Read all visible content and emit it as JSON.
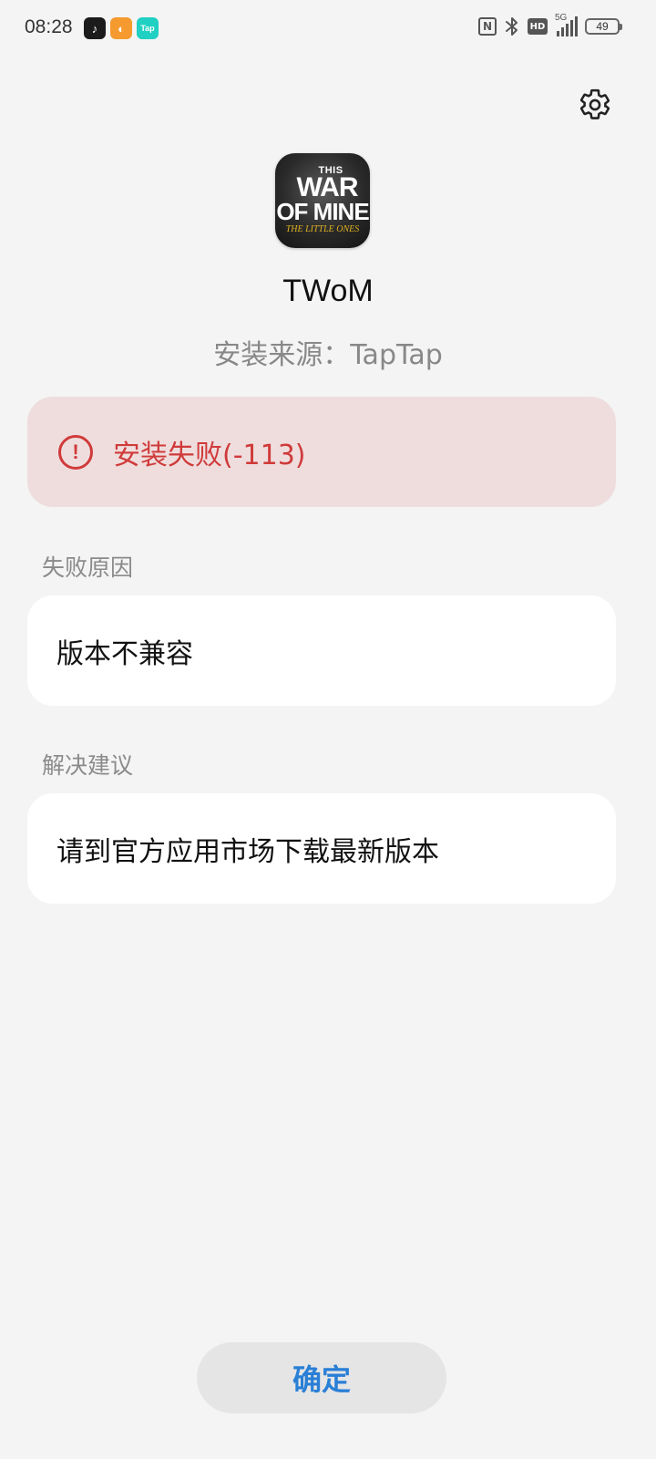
{
  "status_bar": {
    "time": "08:28",
    "notification_icons": [
      "tiktok-icon",
      "orange-app-icon",
      "taptap-icon"
    ],
    "taptap_label": "Tap",
    "network": "5G",
    "hd_label": "HD",
    "nfc_label": "N",
    "battery": "49"
  },
  "app": {
    "icon_text": {
      "line1": "THIS",
      "line2": "WAR",
      "line3": "OF MINE",
      "line4": "THE LITTLE ONES"
    },
    "name": "TWoM",
    "install_source": "安装来源：TapTap"
  },
  "error": {
    "icon_symbol": "!",
    "message": "安装失败(-113)",
    "color": "#d03a3a"
  },
  "failure_reason": {
    "label": "失败原因",
    "value": "版本不兼容"
  },
  "suggestion": {
    "label": "解决建议",
    "value": "请到官方应用市场下载最新版本"
  },
  "confirm_button": {
    "label": "确定",
    "color": "#2a7fd6"
  }
}
